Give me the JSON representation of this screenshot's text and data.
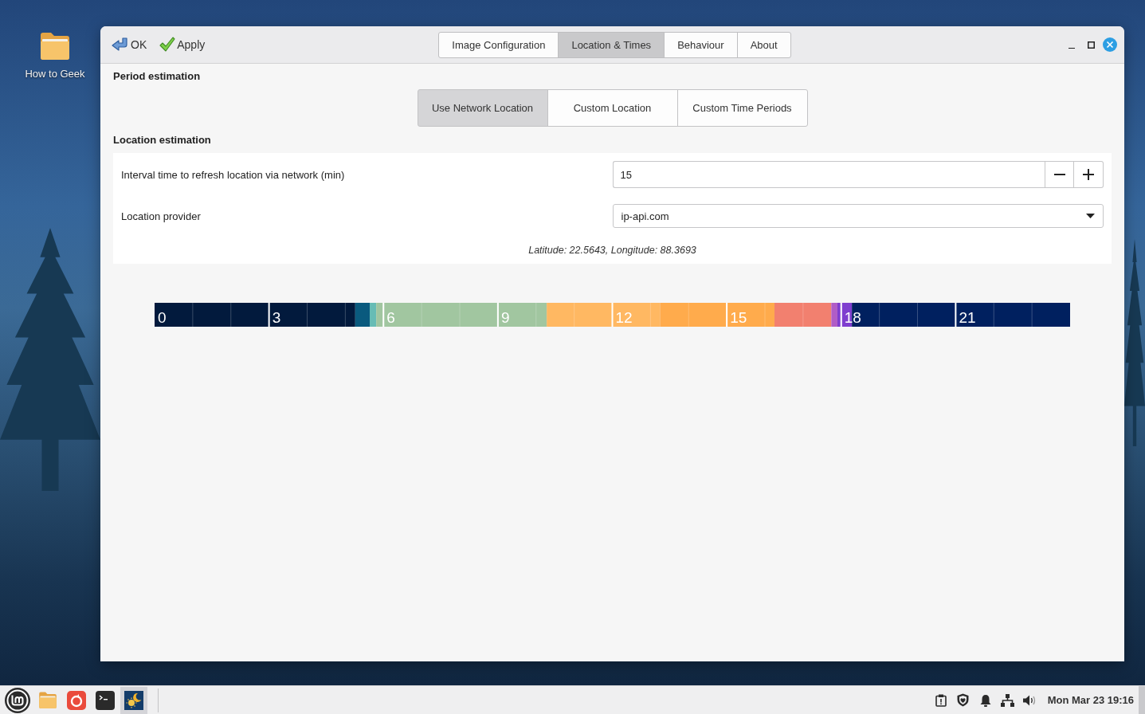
{
  "desktop": {
    "shortcuts": [
      {
        "label": "How to Geek"
      }
    ]
  },
  "window": {
    "actions": [
      {
        "kind": "ok",
        "label": "OK"
      },
      {
        "kind": "apply",
        "label": "Apply"
      }
    ],
    "tabs": [
      {
        "label": "Image Configuration",
        "selected": false
      },
      {
        "label": "Location & Times",
        "selected": true
      },
      {
        "label": "Behaviour",
        "selected": false
      },
      {
        "label": "About",
        "selected": false
      }
    ]
  },
  "period_estimation": {
    "title": "Period estimation",
    "modes": [
      {
        "label": "Use Network Location",
        "selected": true
      },
      {
        "label": "Custom Location",
        "selected": false
      },
      {
        "label": "Custom Time Periods",
        "selected": false
      }
    ]
  },
  "location_estimation": {
    "title": "Location estimation",
    "interval": {
      "label": "Interval time to refresh location via network (min)",
      "value": "15"
    },
    "provider": {
      "label": "Location provider",
      "value": "ip-api.com"
    },
    "coordinates": "Latitude: 22.5643, Longitude: 88.3693"
  },
  "timeline": {
    "hour_labels": [
      "0",
      "3",
      "6",
      "9",
      "12",
      "15",
      "18",
      "21"
    ],
    "periods": [
      {
        "color": "#021a3d"
      },
      {
        "color": "#0a5a7e"
      },
      {
        "color": "#67bcb5"
      },
      {
        "color": "#a1c6a0"
      },
      {
        "color": "#ffb862"
      },
      {
        "color": "#ffab4c"
      },
      {
        "color": "#f2806f"
      },
      {
        "color": "#b05dc6"
      },
      {
        "color": "#7f3ecf"
      },
      {
        "color": "#00205f"
      }
    ]
  },
  "taskbar": {
    "launchers": [
      {
        "kind": "files",
        "active": false
      },
      {
        "kind": "browser",
        "active": false
      },
      {
        "kind": "terminal",
        "active": false
      },
      {
        "kind": "daynight",
        "active": true
      }
    ],
    "clock": "Mon Mar 23 19:16"
  }
}
